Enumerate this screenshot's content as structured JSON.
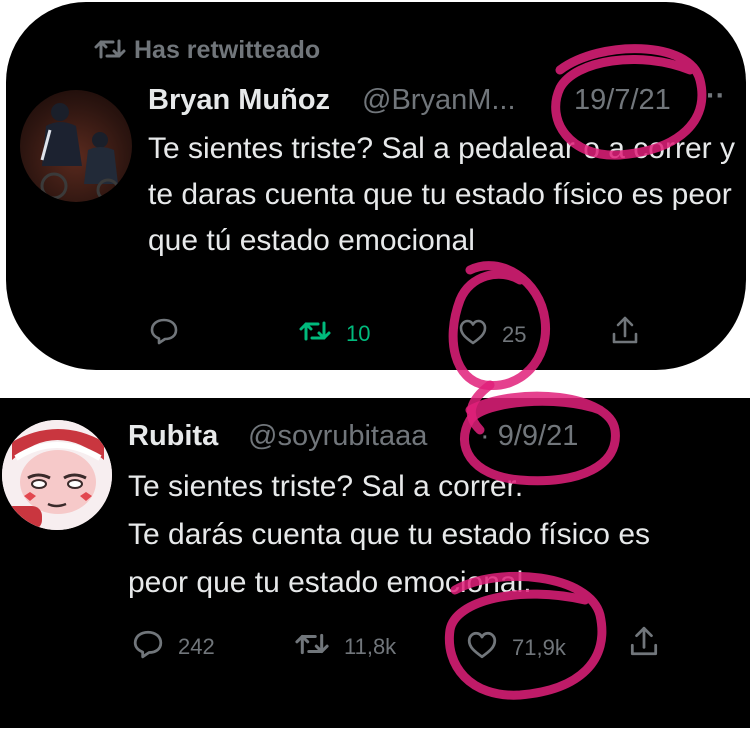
{
  "tweet1": {
    "retweet_label": "Has retwitteado",
    "name": "Bryan Muñoz",
    "handle": "@BryanM...",
    "date": "19/7/21",
    "more": "··",
    "text": "Te sientes triste? Sal a pedalear o a correr y te daras cuenta que tu estado físico es peor que tú estado emocional",
    "emoji": "😉",
    "reply_count": "",
    "retweet_count": "10",
    "like_count": "25"
  },
  "tweet2": {
    "name": "Rubita",
    "handle": "@soyrubitaaa",
    "date": "· 9/9/21",
    "text_line1": "Te sientes triste? Sal a correr.",
    "text_line2": "Te darás cuenta que tu estado físico es",
    "text_line3": "peor que tu estado emocional.",
    "reply_count": "242",
    "retweet_count": "11,8k",
    "like_count": "71,9k"
  },
  "icons": {
    "retweet": "retweet-icon",
    "reply": "reply-icon",
    "like": "heart-icon",
    "share": "share-icon"
  },
  "colors": {
    "background": "#000000",
    "text": "#e7e9ea",
    "muted": "#71767b",
    "retweeted_green": "#00ba7c",
    "annotation_pink": "#e0207a"
  }
}
